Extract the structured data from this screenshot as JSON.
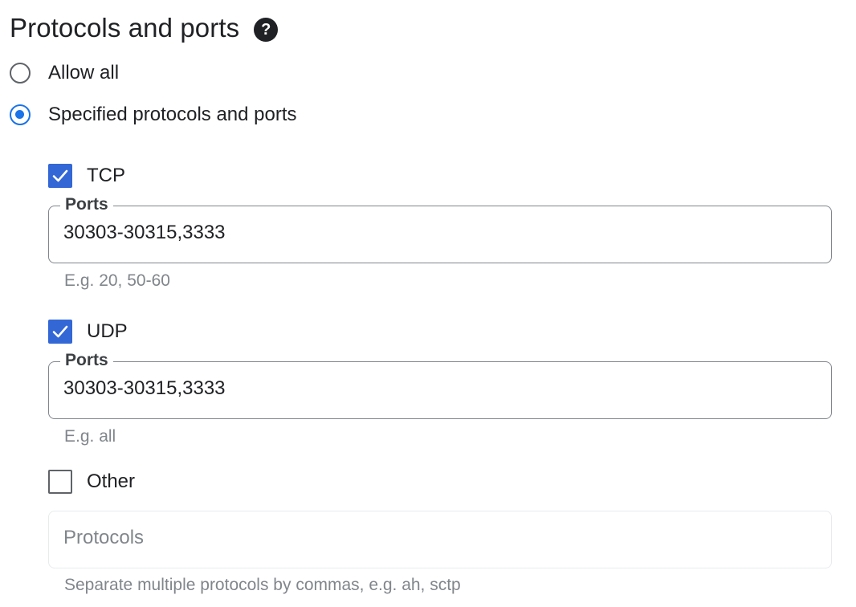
{
  "section": {
    "title": "Protocols and ports",
    "help_icon": "help-circle-icon"
  },
  "mode": {
    "options": [
      {
        "label": "Allow all",
        "selected": false
      },
      {
        "label": "Specified protocols and ports",
        "selected": true
      }
    ]
  },
  "tcp": {
    "label": "TCP",
    "checked": true,
    "ports_label": "Ports",
    "ports_value": "30303-30315,3333",
    "hint": "E.g. 20, 50-60"
  },
  "udp": {
    "label": "UDP",
    "checked": true,
    "ports_label": "Ports",
    "ports_value": "30303-30315,3333",
    "hint": "E.g. all"
  },
  "other": {
    "label": "Other",
    "checked": false,
    "protocols_placeholder": "Protocols",
    "hint": "Separate multiple protocols by commas, e.g. ah, sctp"
  },
  "colors": {
    "accent": "#1a73e8",
    "checkbox_fill": "#3367d6",
    "text": "#202124",
    "hint": "#80868b"
  }
}
